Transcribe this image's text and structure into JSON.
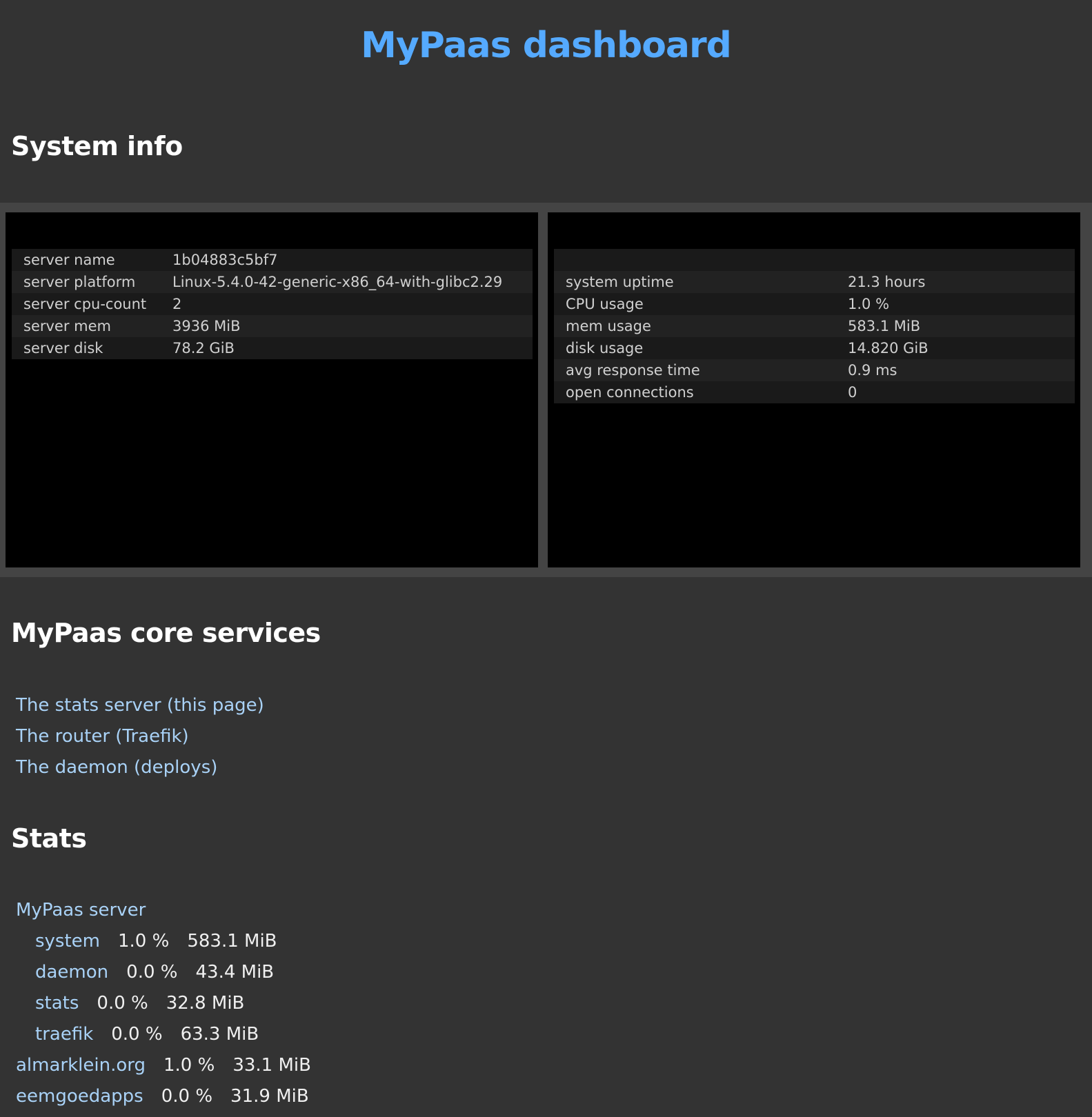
{
  "header": {
    "title": "MyPaas dashboard"
  },
  "system_info": {
    "heading": "System info",
    "server": [
      {
        "label": "server name",
        "value": "1b04883c5bf7"
      },
      {
        "label": "server platform",
        "value": "Linux-5.4.0-42-generic-x86_64-with-glibc2.29"
      },
      {
        "label": "server cpu-count",
        "value": "2"
      },
      {
        "label": "server mem",
        "value": "3936 MiB"
      },
      {
        "label": "server disk",
        "value": "78.2 GiB"
      }
    ],
    "usage": [
      {
        "label": "system uptime",
        "value": "21.3 hours"
      },
      {
        "label": "CPU usage",
        "value": "1.0 %"
      },
      {
        "label": "mem usage",
        "value": "583.1 MiB"
      },
      {
        "label": "disk usage",
        "value": "14.820 GiB"
      },
      {
        "label": "avg response time",
        "value": "0.9 ms"
      },
      {
        "label": "open connections",
        "value": "0"
      }
    ]
  },
  "core_services": {
    "heading": "MyPaas core services",
    "links": [
      "The stats server (this page)",
      "The router (Traefik)",
      "The daemon (deploys)"
    ]
  },
  "stats": {
    "heading": "Stats",
    "server_label": "MyPaas server",
    "server_items": [
      {
        "name": "system",
        "cpu": "1.0 %",
        "mem": "583.1 MiB"
      },
      {
        "name": "daemon",
        "cpu": "0.0 %",
        "mem": "43.4 MiB"
      },
      {
        "name": "stats",
        "cpu": "0.0 %",
        "mem": "32.8 MiB"
      },
      {
        "name": "traefik",
        "cpu": "0.0 %",
        "mem": "63.3 MiB"
      }
    ],
    "apps": [
      {
        "name": "almarklein.org",
        "cpu": "1.0 %",
        "mem": "33.1 MiB"
      },
      {
        "name": "eemgoedapps",
        "cpu": "0.0 %",
        "mem": "31.9 MiB"
      }
    ]
  }
}
